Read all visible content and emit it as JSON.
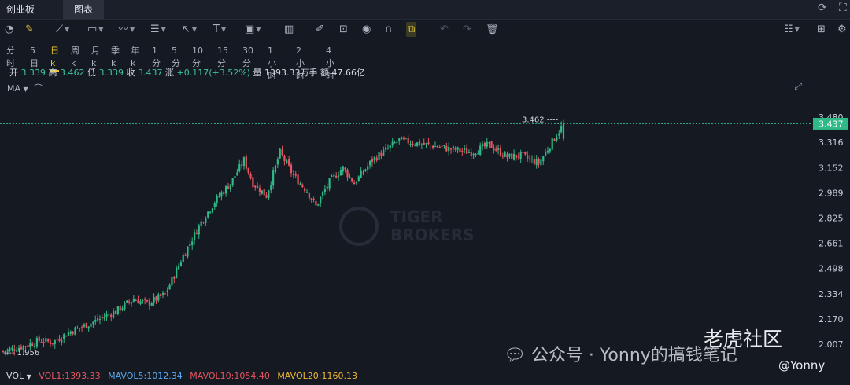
{
  "tabs": [
    {
      "label": "创业板"
    },
    {
      "label": "图表"
    }
  ],
  "periods": [
    "分时",
    "5日",
    "日k",
    "周k",
    "月k",
    "季k",
    "年k",
    "1分",
    "5分",
    "10分",
    "15分",
    "30分",
    "1小时",
    "2小时",
    "4小时"
  ],
  "active_period": "日k",
  "ohlc": {
    "open_label": "开",
    "open": "3.339",
    "high_label": "高",
    "high": "3.462",
    "low_label": "低",
    "low": "3.339",
    "close_label": "收",
    "close": "3.437",
    "change_label": "涨",
    "change": "+0.117(+3.52%)",
    "volume_label": "量",
    "volume": "1393.33万手",
    "amount_label": "额",
    "amount": "47.66亿"
  },
  "indicator": {
    "label": "MA"
  },
  "volume_bar": {
    "label": "VOL",
    "vol1": "VOL1:1393.33",
    "mavol5": "MAVOL5:1012.34",
    "mavol10": "MAVOL10:1054.40",
    "mavol20": "MAVOL20:1160.13"
  },
  "colors": {
    "up": "#2fb986",
    "down": "#e8545f",
    "mavol5": "#5aa9f0",
    "mavol10": "#e8545f",
    "mavol20": "#f0b735",
    "accent": "#f0c52e"
  },
  "watermark": {
    "line1": "TIGER",
    "line2": "BROKERS",
    "community": "老虎社区",
    "author": "@Yonny",
    "wechat": "公众号 · Yonny的搞钱笔记"
  },
  "chart_data": {
    "type": "candlestick",
    "y_ticks": [
      "3.480",
      "3.316",
      "3.152",
      "2.989",
      "2.825",
      "2.661",
      "2.498",
      "2.334",
      "2.170",
      "2.007"
    ],
    "ylim": [
      1.93,
      3.52
    ],
    "last_price": "3.437",
    "high_marker": "3.462",
    "low_marker": "1.956",
    "keypoints": [
      [
        0,
        1.96
      ],
      [
        8,
        1.99
      ],
      [
        16,
        2.03
      ],
      [
        22,
        2.02
      ],
      [
        30,
        2.09
      ],
      [
        40,
        2.15
      ],
      [
        50,
        2.22
      ],
      [
        58,
        2.3
      ],
      [
        64,
        2.27
      ],
      [
        72,
        2.33
      ],
      [
        80,
        2.58
      ],
      [
        88,
        2.8
      ],
      [
        95,
        2.95
      ],
      [
        101,
        3.05
      ],
      [
        107,
        3.2
      ],
      [
        111,
        3.05
      ],
      [
        117,
        2.97
      ],
      [
        123,
        3.25
      ],
      [
        129,
        3.1
      ],
      [
        135,
        3.0
      ],
      [
        139,
        2.9
      ],
      [
        145,
        3.06
      ],
      [
        151,
        3.15
      ],
      [
        156,
        3.05
      ],
      [
        164,
        3.2
      ],
      [
        176,
        3.33
      ],
      [
        188,
        3.3
      ],
      [
        200,
        3.27
      ],
      [
        208,
        3.25
      ],
      [
        216,
        3.3
      ],
      [
        224,
        3.22
      ],
      [
        230,
        3.23
      ],
      [
        238,
        3.18
      ],
      [
        244,
        3.32
      ],
      [
        249,
        3.437
      ]
    ]
  }
}
